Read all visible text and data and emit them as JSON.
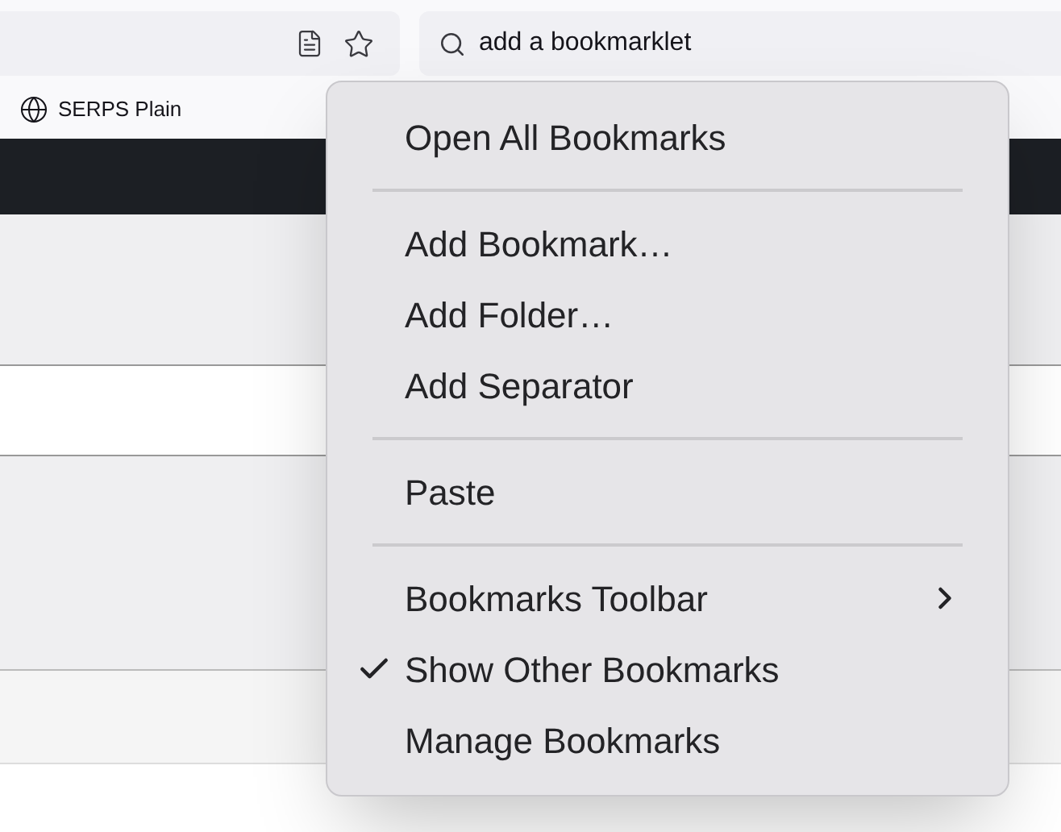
{
  "toolbar": {
    "search": {
      "value": "add a bookmarklet"
    }
  },
  "bookmarks_bar": {
    "items": [
      {
        "label": "SERPS Plain"
      }
    ]
  },
  "context_menu": {
    "items": [
      {
        "kind": "item",
        "label": "Open All Bookmarks"
      },
      {
        "kind": "separator"
      },
      {
        "kind": "item",
        "label": "Add Bookmark…"
      },
      {
        "kind": "item",
        "label": "Add Folder…"
      },
      {
        "kind": "item",
        "label": "Add Separator"
      },
      {
        "kind": "separator"
      },
      {
        "kind": "item",
        "label": "Paste"
      },
      {
        "kind": "separator"
      },
      {
        "kind": "submenu",
        "label": "Bookmarks Toolbar"
      },
      {
        "kind": "check",
        "label": "Show Other Bookmarks",
        "checked": true
      },
      {
        "kind": "item",
        "label": "Manage Bookmarks"
      }
    ]
  }
}
